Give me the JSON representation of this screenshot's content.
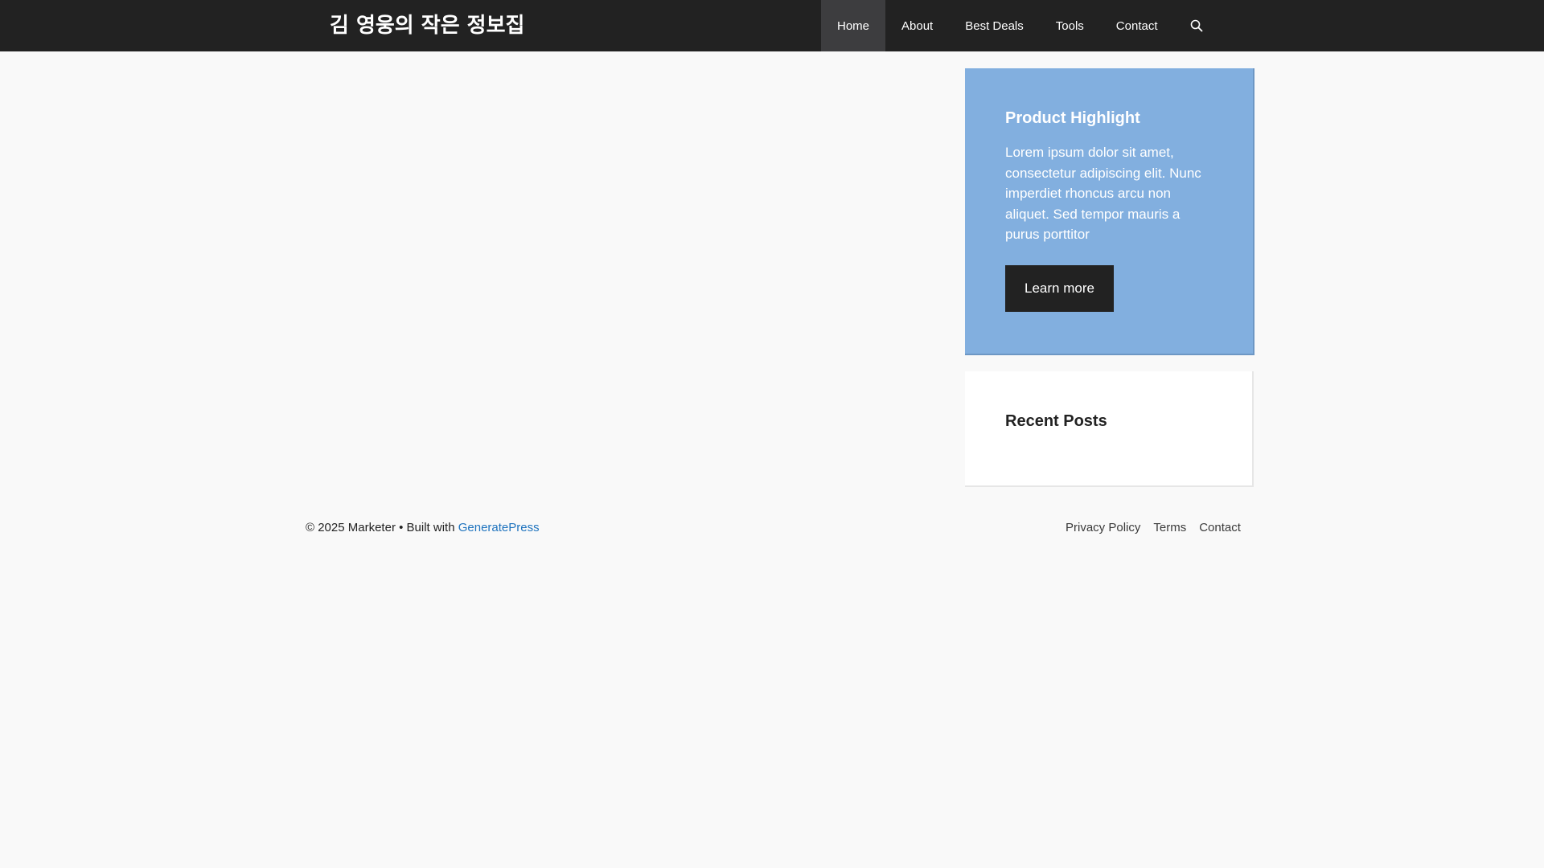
{
  "header": {
    "site_title": "김 영웅의 작은 정보집",
    "nav": [
      {
        "label": "Home",
        "active": true
      },
      {
        "label": "About",
        "active": false
      },
      {
        "label": "Best Deals",
        "active": false
      },
      {
        "label": "Tools",
        "active": false
      },
      {
        "label": "Contact",
        "active": false
      }
    ],
    "search_icon": "search-icon"
  },
  "sidebar": {
    "highlight": {
      "title": "Product Highlight",
      "text": "Lorem ipsum dolor sit amet, consectetur adipiscing elit. Nunc imperdiet rhoncus arcu non aliquet. Sed tempor mauris a purus porttitor",
      "button_label": "Learn more"
    },
    "recent_posts": {
      "title": "Recent Posts"
    }
  },
  "footer": {
    "copyright": "© 2025 Marketer • Built with ",
    "builder_link": "GeneratePress",
    "links": [
      "Privacy Policy",
      "Terms",
      "Contact"
    ]
  },
  "colors": {
    "topbar": "#222222",
    "active_nav": "#3d3d3f",
    "highlight_bg": "#82afdf",
    "page_bg": "#f9f9f9",
    "link": "#1e73be"
  }
}
